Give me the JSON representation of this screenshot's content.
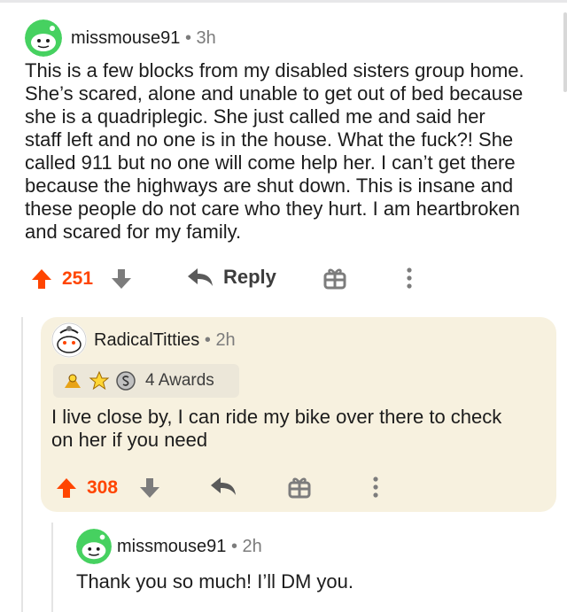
{
  "comments": [
    {
      "username": "missmouse91",
      "separator": "•",
      "time": "3h",
      "lines": [
        "This is a few blocks from my disabled sisters group home.",
        "She’s scared, alone and unable to get out of bed because",
        "she is a quadriplegic. She just called me and said her",
        "staff left and no one is in the house. What the fuck?! She",
        "called 911 but no one will come help her. I can’t get there",
        "because the highways are shut down. This is insane and",
        "these people do not care who they hurt. I am heartbroken",
        "and scared for my family."
      ],
      "score": "251",
      "reply_label": "Reply"
    },
    {
      "username": "RadicalTitties",
      "separator": "•",
      "time": "2h",
      "awards_label": "4 Awards",
      "lines": [
        "I live close by, I can ride my bike over there to check",
        "on her if you need"
      ],
      "score": "308"
    },
    {
      "username": "missmouse91",
      "separator": "•",
      "time": "2h",
      "lines": [
        "Thank you so much! I’ll DM you."
      ]
    }
  ],
  "colors": {
    "upvote": "#ff4500",
    "icon_gray": "#7c7c7c",
    "highlight_bg": "#f7f1df",
    "avatar_green": "#46d160"
  },
  "icons": [
    "upvote-icon",
    "downvote-icon",
    "reply-icon",
    "gift-icon",
    "more-options-icon",
    "award-icon"
  ]
}
